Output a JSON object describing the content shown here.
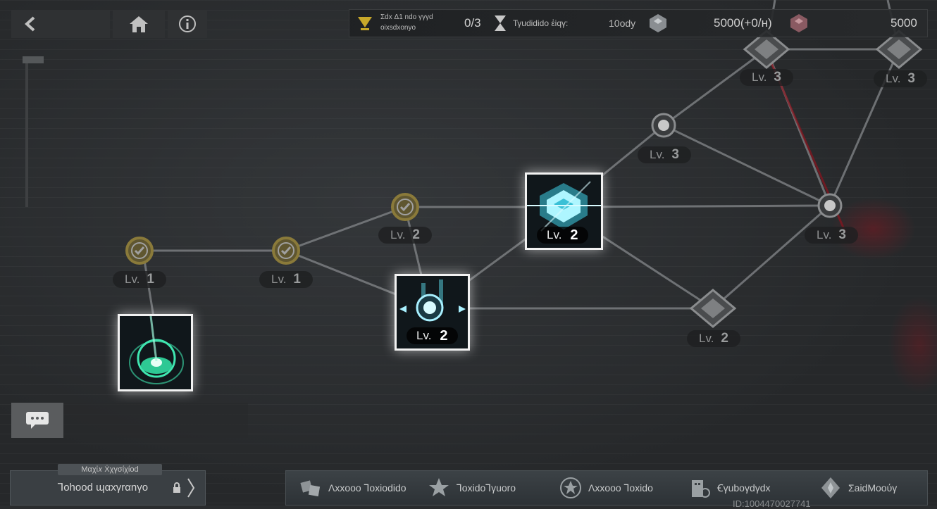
{
  "top_nav": {
    "back_icon": "back-arrow-icon",
    "home_icon": "home-icon",
    "info_icon": "info-icon"
  },
  "resources": {
    "quest_label_1": "Σdx Δ1 ndo γγγd",
    "quest_label_2": "oixsdxonyo",
    "quest_progress": "0/3",
    "time_label": "Τγudidido ἐiqγ:",
    "time_value": "10ody",
    "currency1_value": "5000(+0/н)",
    "currency2_value": "5000"
  },
  "nodes": {
    "n_a": {
      "lv": "Lv.",
      "num": "1"
    },
    "n_b": {
      "lv": "Lv.",
      "num": "1"
    },
    "n_c": {
      "lv": "Lv.",
      "num": "2"
    },
    "n_d": {
      "lv": "Lv.",
      "num": "3"
    },
    "n_e": {
      "lv": "Lv.",
      "num": "3"
    },
    "n_f": {
      "lv": "Lv.",
      "num": "3"
    },
    "n_g": {
      "lv": "Lv.",
      "num": "3"
    },
    "n_h": {
      "lv": "Lv.",
      "num": "2"
    },
    "card_mid": {
      "lv": "Lv.",
      "num": "2"
    },
    "card_top": {
      "lv": "Lv.",
      "num": "2"
    }
  },
  "bottom": {
    "left_tag": "Μαχἰ𝑥 Ẋχγσίχίοd",
    "left_title": "Ꞁohood ɰαxγrαnγo",
    "tabs": [
      {
        "label": "Λxxooo Ꞁoxiodido",
        "icon": "dice-icon"
      },
      {
        "label": "ꞀoxidoꞀγuoro",
        "icon": "star-badge-icon"
      },
      {
        "label": "Λxxooo Ꞁoxido",
        "icon": "star-circle-icon"
      },
      {
        "label": "Ꞓγuboγdγdx",
        "icon": "building-icon"
      },
      {
        "label": "ΣaidΜooύγ",
        "icon": "crest-icon"
      }
    ],
    "id_text": "ID:1004470027741"
  },
  "colors": {
    "accent": "#3fe6b0",
    "card_border": "#f2f2f2",
    "node_gold": "#8a7a3a",
    "red_glow": "#8c141e"
  }
}
